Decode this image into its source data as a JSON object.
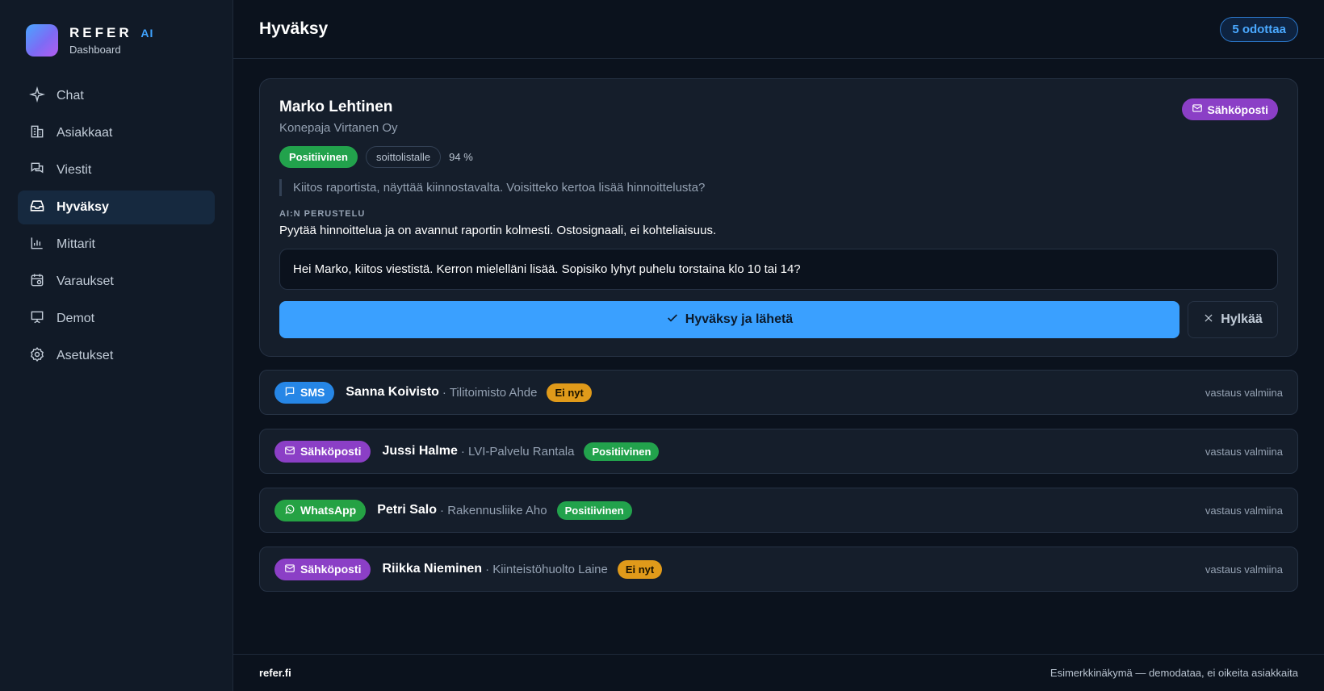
{
  "brand": {
    "name": "REFER",
    "ai": "AI",
    "sub": "Dashboard"
  },
  "nav": [
    {
      "label": "Chat",
      "icon": "sparkle-icon"
    },
    {
      "label": "Asiakkaat",
      "icon": "building-icon"
    },
    {
      "label": "Viestit",
      "icon": "messages-icon"
    },
    {
      "label": "Hyväksy",
      "icon": "inbox-icon",
      "active": true
    },
    {
      "label": "Mittarit",
      "icon": "bar-chart-icon"
    },
    {
      "label": "Varaukset",
      "icon": "calendar-icon"
    },
    {
      "label": "Demot",
      "icon": "presentation-icon"
    },
    {
      "label": "Asetukset",
      "icon": "gear-icon"
    }
  ],
  "header": {
    "title": "Hyväksy",
    "pending": "5 odottaa"
  },
  "featured": {
    "name": "Marko Lehtinen",
    "company": "Konepaja Virtanen Oy",
    "channel": "Sähköposti",
    "sentiment": "Positiivinen",
    "tag": "soittolistalle",
    "score": "94 %",
    "quote": "Kiitos raportista, näyttää kiinnostavalta. Voisitteko kertoa lisää hinnoittelusta?",
    "reason_label": "AI:N PERUSTELU",
    "reason": "Pyytää hinnoittelua ja on avannut raportin kolmesti. Ostosignaali, ei kohteliaisuus.",
    "reply": "Hei Marko, kiitos viestistä. Kerron mielelläni lisää. Sopisiko lyhyt puhelu torstaina klo 10 tai 14?",
    "approve_label": "Hyväksy ja lähetä",
    "reject_label": "Hylkää"
  },
  "queue": [
    {
      "channel": "SMS",
      "channel_type": "sms",
      "name": "Sanna Koivisto",
      "company": "· Tilitoimisto Ahde",
      "sentiment": "Ei nyt",
      "sentiment_type": "later",
      "status": "vastaus valmiina"
    },
    {
      "channel": "Sähköposti",
      "channel_type": "email",
      "name": "Jussi Halme",
      "company": "· LVI-Palvelu Rantala",
      "sentiment": "Positiivinen",
      "sentiment_type": "pos",
      "status": "vastaus valmiina"
    },
    {
      "channel": "WhatsApp",
      "channel_type": "wa",
      "name": "Petri Salo",
      "company": "· Rakennusliike Aho",
      "sentiment": "Positiivinen",
      "sentiment_type": "pos",
      "status": "vastaus valmiina"
    },
    {
      "channel": "Sähköposti",
      "channel_type": "email",
      "name": "Riikka Nieminen",
      "company": "· Kiinteistöhuolto Laine",
      "sentiment": "Ei nyt",
      "sentiment_type": "later",
      "status": "vastaus valmiina"
    }
  ],
  "footer": {
    "left": "refer.fi",
    "right": "Esimerkkinäkymä — demodataa, ei oikeita asiakkaita"
  },
  "colors": {
    "accent": "#3aa0ff",
    "email": "#8b3fc6",
    "sms": "#2686e6",
    "whatsapp": "#25a244",
    "positive": "#22a24c",
    "later": "#e09a1a"
  }
}
